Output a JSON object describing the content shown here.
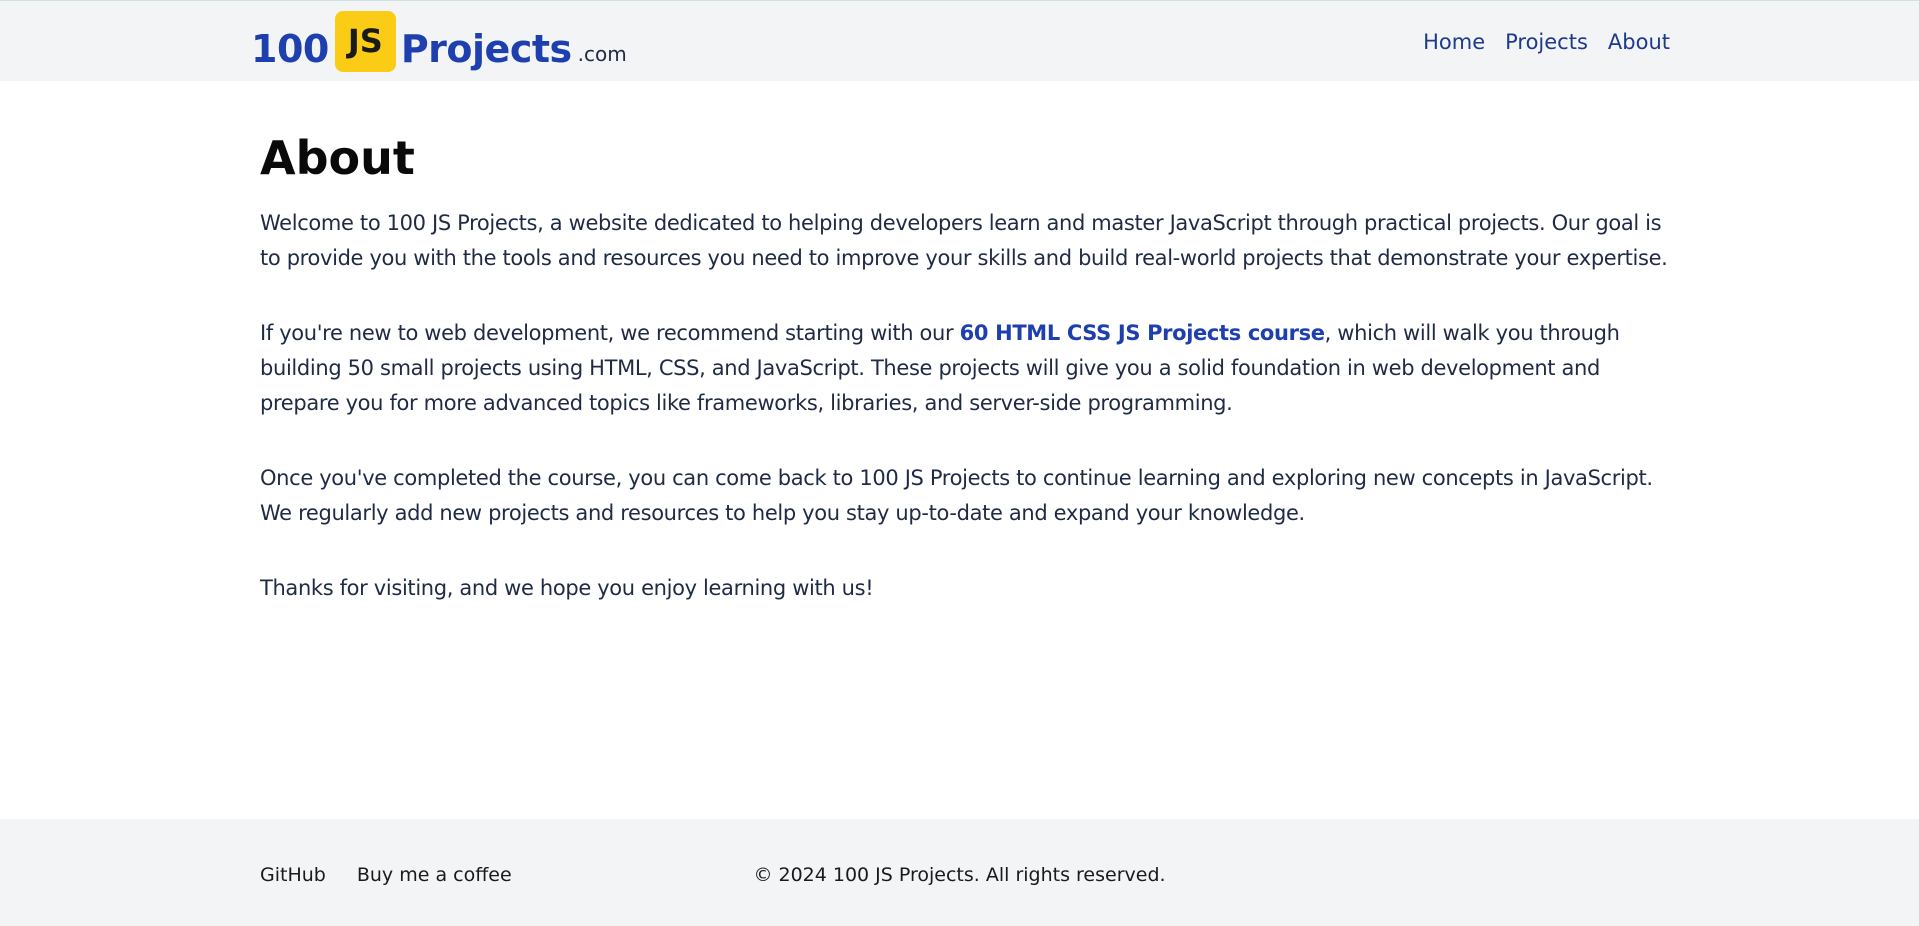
{
  "header": {
    "logo": {
      "number": "100",
      "badge": "JS",
      "word": "Projects",
      "tld": ".com"
    },
    "nav": [
      {
        "label": "Home"
      },
      {
        "label": "Projects"
      },
      {
        "label": "About"
      }
    ]
  },
  "main": {
    "title": "About",
    "p1": "Welcome to 100 JS Projects, a website dedicated to helping developers learn and master JavaScript through practical projects. Our goal is to provide you with the tools and resources you need to improve your skills and build real-world projects that demonstrate your expertise.",
    "p2_before": "If you're new to web development, we recommend starting with our ",
    "p2_link": "60 HTML CSS JS Projects course",
    "p2_after": ", which will walk you through building 50 small projects using HTML, CSS, and JavaScript. These projects will give you a solid foundation in web development and prepare you for more advanced topics like frameworks, libraries, and server-side programming.",
    "p3": "Once you've completed the course, you can come back to 100 JS Projects to continue learning and exploring new concepts in JavaScript. We regularly add new projects and resources to help you stay up-to-date and expand your knowledge.",
    "p4": "Thanks for visiting, and we hope you enjoy learning with us!"
  },
  "footer": {
    "links": [
      {
        "label": "GitHub"
      },
      {
        "label": "Buy me a coffee"
      }
    ],
    "copyright": "© 2024 100 JS Projects. All rights reserved."
  },
  "colors": {
    "brand_blue": "#1e40af",
    "badge_yellow": "#facc15",
    "header_bg": "#f3f4f6"
  }
}
